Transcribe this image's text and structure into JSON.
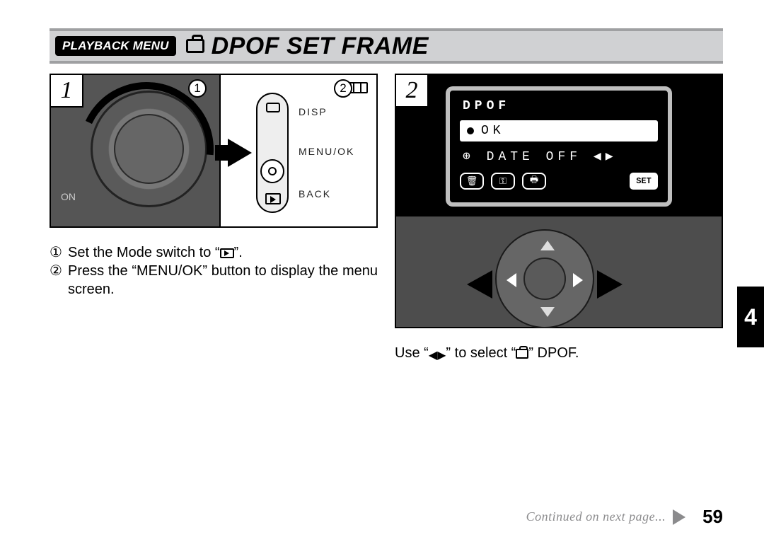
{
  "header": {
    "badge_label": "PLAYBACK MENU",
    "title": "DPOF SET FRAME"
  },
  "steps": {
    "s1_badge": "1",
    "s2_badge": "2"
  },
  "fig1": {
    "callout1": "1",
    "callout2": "2",
    "on_label": "ON",
    "label_disp": "DISP",
    "label_menuok": "MENU/OK",
    "label_back": "BACK"
  },
  "lcd": {
    "title": "DPOF",
    "selected": "OK",
    "date_line": "DATE OFF",
    "set_label": "SET"
  },
  "instructions": {
    "step1_num": "①",
    "step1_a": "Set the Mode switch to “",
    "step1_b": "”.",
    "step2_num": "②",
    "step2": "Press the “MENU/OK” button to display the menu screen.",
    "col2_a": "Use “",
    "col2_b": "” to select “",
    "col2_c": "” DPOF."
  },
  "side_tab": "4",
  "footer": {
    "continued": "Continued on next page...",
    "page_number": "59"
  }
}
